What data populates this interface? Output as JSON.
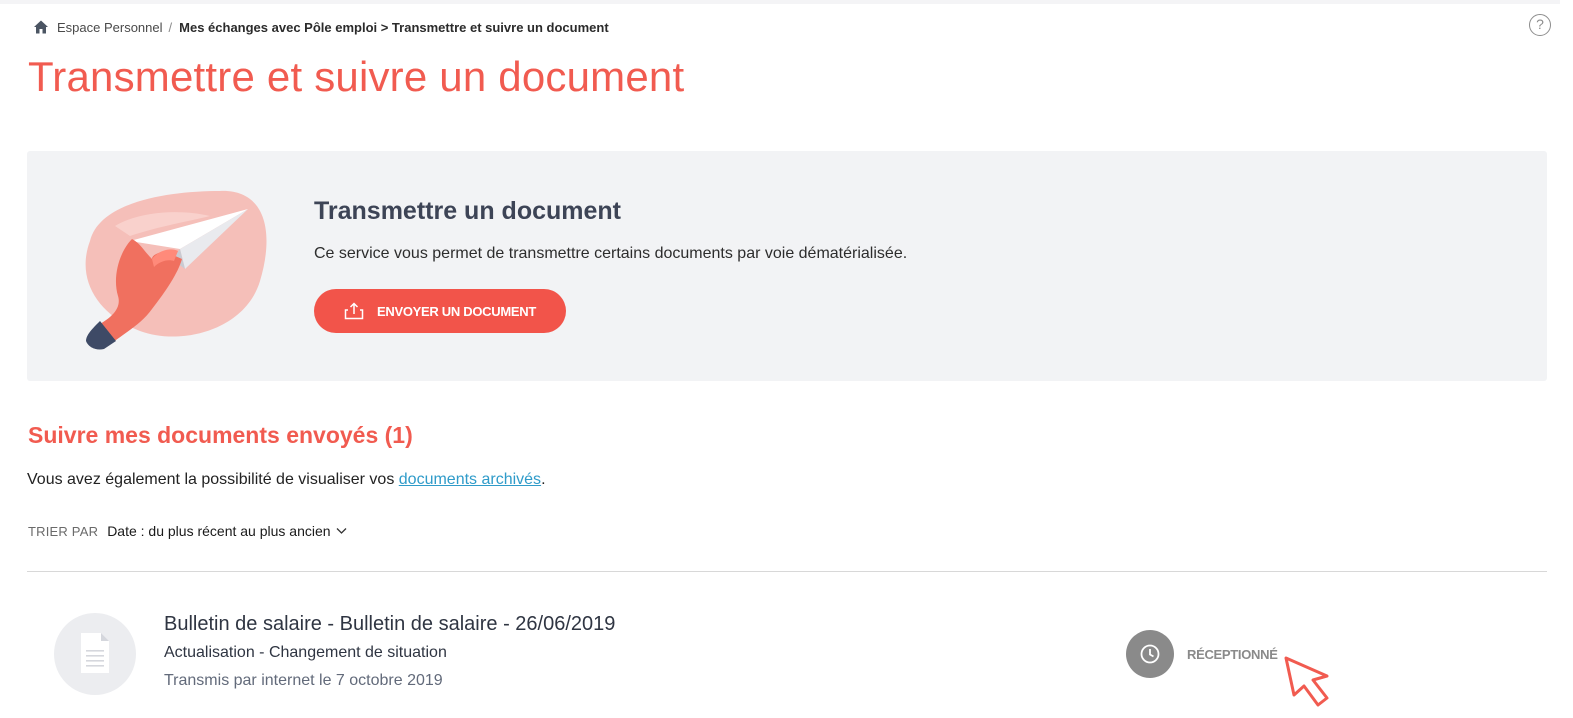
{
  "breadcrumb": {
    "home_icon": "home-icon",
    "root": "Espace Personnel",
    "separator": "/",
    "current": "Mes échanges avec Pôle emploi > Transmettre et suivre un document"
  },
  "help": {
    "icon": "question-circle-icon",
    "glyph": "?"
  },
  "page": {
    "title": "Transmettre et suivre un document"
  },
  "hero": {
    "illustration": "paper-plane-hand-illustration",
    "title": "Transmettre un document",
    "description": "Ce service vous permet de transmettre certains documents par voie dématérialisée.",
    "button": {
      "label": "ENVOYER UN DOCUMENT",
      "icon": "upload-icon"
    }
  },
  "tracking": {
    "title": "Suivre mes documents envoyés (1)",
    "archive_prefix": "Vous avez également la possibilité de visualiser vos ",
    "archive_link": "documents archivés",
    "archive_suffix": ".",
    "sort_label": "TRIER PAR",
    "sort_value": "Date : du plus récent au plus ancien"
  },
  "documents": [
    {
      "icon": "document-icon",
      "title": "Bulletin de salaire - Bulletin de salaire - 26/06/2019",
      "subtitle": "Actualisation - Changement de situation",
      "date": "Transmis par internet le 7 octobre 2019",
      "status": {
        "label": "RÉCEPTIONNÉ",
        "icon": "clock-icon"
      }
    }
  ],
  "colors": {
    "accent": "#f15b50",
    "button": "#f2544a",
    "link": "#2f9bc9",
    "panel": "#f2f3f5",
    "status": "#8a8a8a"
  }
}
